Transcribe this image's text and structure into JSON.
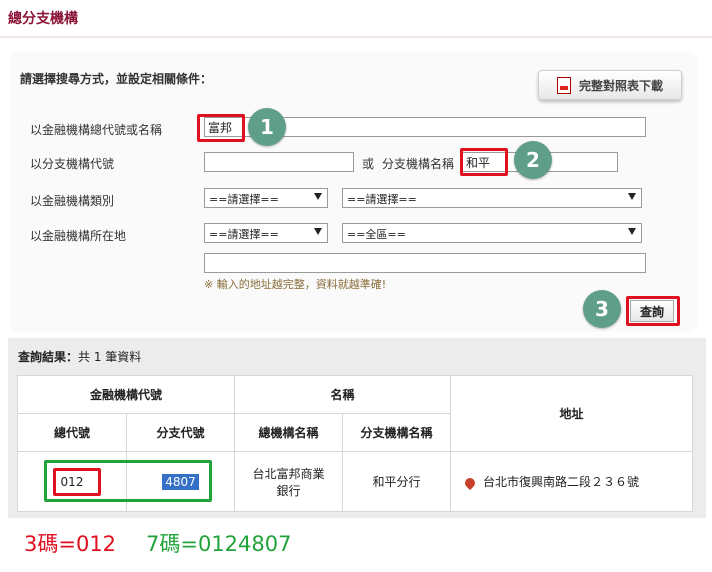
{
  "page": {
    "title": "總分支機構"
  },
  "form": {
    "heading": "請選擇搜尋方式，並設定相關條件：",
    "download_button": "完整對照表下載",
    "row1": {
      "label": "以金融機構總代號或名稱",
      "value": "富邦"
    },
    "row2": {
      "label": "以分支機構代號",
      "value": "",
      "or_text": "或",
      "name_label": "分支機構名稱",
      "name_value": "和平"
    },
    "row3": {
      "label": "以金融機構類別",
      "select1": "==請選擇==",
      "select2": "==請選擇=="
    },
    "row4": {
      "label": "以金融機構所在地",
      "select1": "==請選擇==",
      "select2": "==全區=="
    },
    "address_value": "",
    "hint": "※ 輸入的地址越完整，資料就越準確!",
    "query_button": "查詢"
  },
  "steps": [
    "1",
    "2",
    "3"
  ],
  "results": {
    "count_label": "查詢結果：",
    "count_text": "共 1 筆資料",
    "headers": {
      "institution_code": "金融機構代號",
      "name": "名稱",
      "address": "地址",
      "head_code": "總代號",
      "branch_code": "分支代號",
      "head_name": "總機構名稱",
      "branch_name": "分支機構名稱"
    },
    "rows": [
      {
        "head_code": "012",
        "branch_code": "4807",
        "head_name": "台北富邦商業銀行",
        "branch_name": "和平分行",
        "address": "台北市復興南路二段２３６號"
      }
    ]
  },
  "notes": {
    "red": "3碼=012",
    "green": "7碼=0124807"
  },
  "colors": {
    "title": "#8b1538",
    "annotation_red": "#e01020",
    "annotation_green": "#22a33a",
    "step_badge": "#5f9e88",
    "highlight": "#3470c8"
  }
}
